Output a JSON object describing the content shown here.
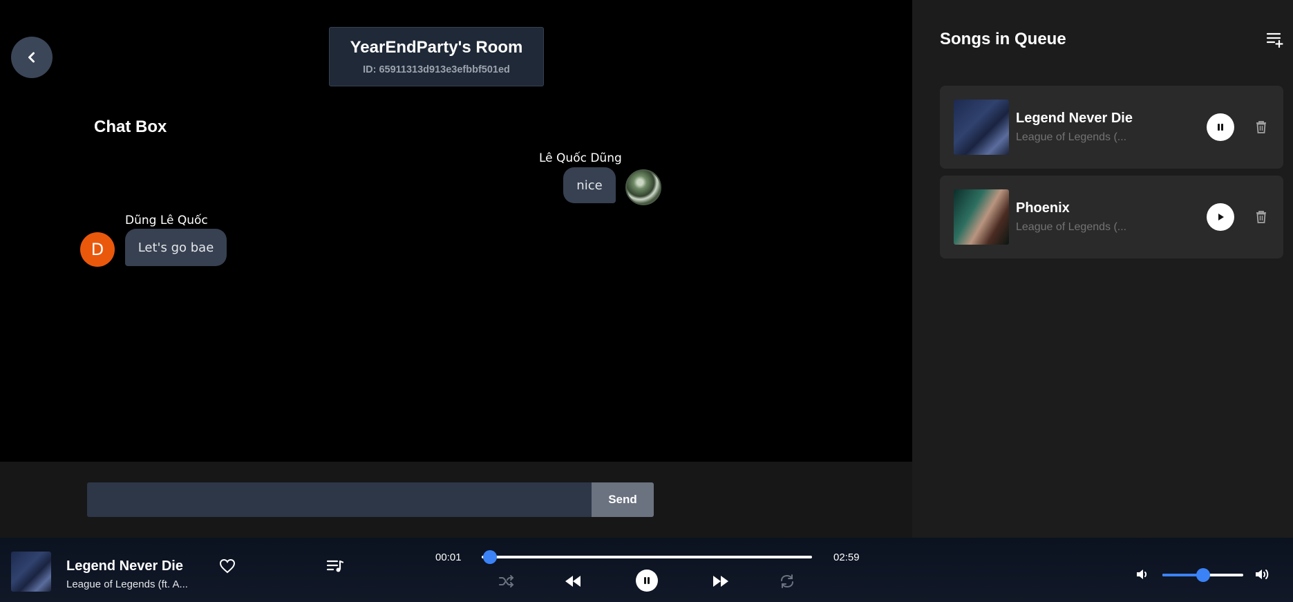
{
  "room": {
    "title": "YearEndParty's Room",
    "id_text": "ID: 65911313d913e3efbbf501ed"
  },
  "chat": {
    "title": "Chat Box",
    "messages": [
      {
        "author": "Lê Quốc Dũng",
        "text": "nice",
        "side": "right",
        "avatar": "photo"
      },
      {
        "author": "Dũng Lê Quốc",
        "text": "Let's go bae",
        "side": "left",
        "avatar": "D"
      }
    ],
    "input_value": "",
    "input_placeholder": "",
    "send_label": "Send"
  },
  "queue": {
    "title": "Songs in Queue",
    "items": [
      {
        "name": "Legend Never Die",
        "artist": "League of Legends (...",
        "state": "playing"
      },
      {
        "name": "Phoenix",
        "artist": "League of Legends (...",
        "state": "paused"
      }
    ]
  },
  "player": {
    "title": "Legend Never Die",
    "artist": "League of Legends (ft. A...",
    "current_time": "00:01",
    "duration": "02:59",
    "progress_fraction": 0.025,
    "volume_fraction": 0.5,
    "state": "playing"
  },
  "colors": {
    "accent": "#3b82f6",
    "avatar_letter_bg": "#ea580c",
    "bubble_bg": "#374151",
    "sidebar_bg": "#1c1c1c"
  }
}
